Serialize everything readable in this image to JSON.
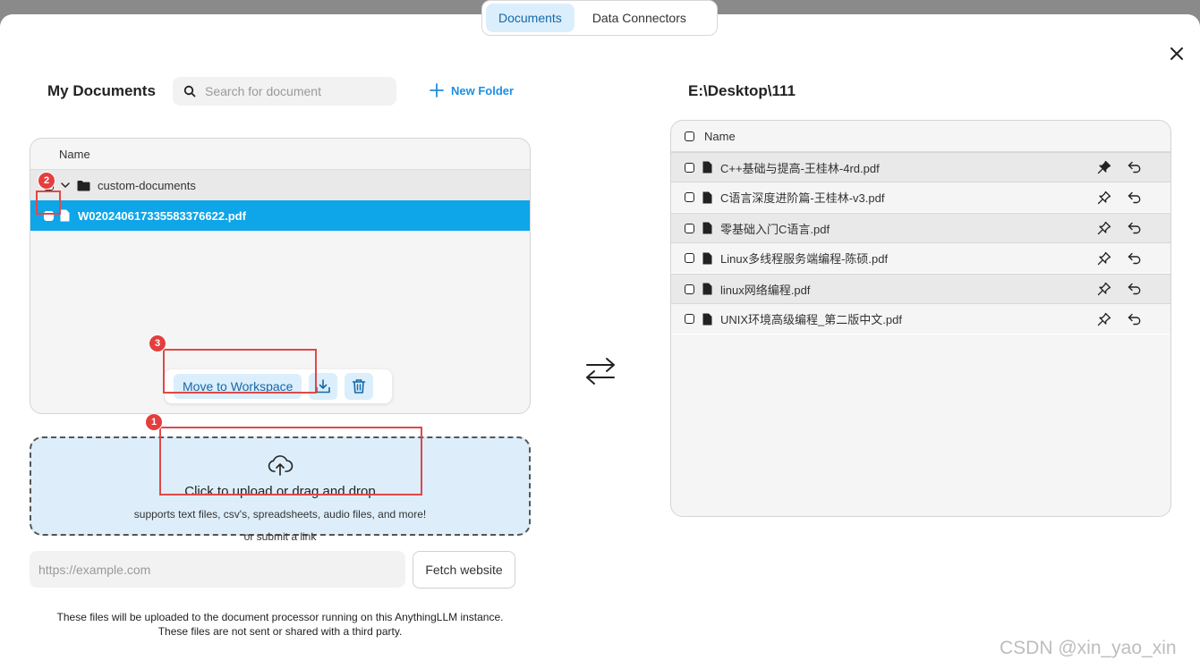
{
  "tabs": [
    {
      "label": "Documents",
      "active": true
    },
    {
      "label": "Data Connectors",
      "active": false
    }
  ],
  "left": {
    "title": "My Documents",
    "search_placeholder": "Search for document",
    "new_folder_label": "New Folder",
    "column_header": "Name",
    "folder_name": "custom-documents",
    "selected_file": "W020240617335583376622.pdf",
    "move_button_label": "Move to Workspace"
  },
  "badges": {
    "one": "1",
    "two": "2",
    "three": "3"
  },
  "upload": {
    "title": "Click to upload or drag and drop",
    "subtitle": "supports text files, csv's, spreadsheets, audio files, and more!",
    "or_link": "or submit a link",
    "url_placeholder": "https://example.com",
    "fetch_label": "Fetch website",
    "footnote_line1": "These files will be uploaded to the document processor running on this AnythingLLM instance.",
    "footnote_line2": "These files are not sent or shared with a third party."
  },
  "right": {
    "title": "E:\\Desktop\\111",
    "column_header": "Name",
    "files": [
      {
        "name": "C++基础与提高-王桂林-4rd.pdf",
        "pinned": true
      },
      {
        "name": "C语言深度进阶篇-王桂林-v3.pdf",
        "pinned": false
      },
      {
        "name": "零基础入门C语言.pdf",
        "pinned": false
      },
      {
        "name": "Linux多线程服务端编程-陈硕.pdf",
        "pinned": false
      },
      {
        "name": "linux网络编程.pdf",
        "pinned": false
      },
      {
        "name": "UNIX环境高级编程_第二版中文.pdf",
        "pinned": false
      }
    ]
  },
  "watermark": "CSDN @xin_yao_xin",
  "colors": {
    "accent": "#0ea5e9",
    "highlight": "#e04848",
    "tab_active_bg": "#dbeefb"
  }
}
